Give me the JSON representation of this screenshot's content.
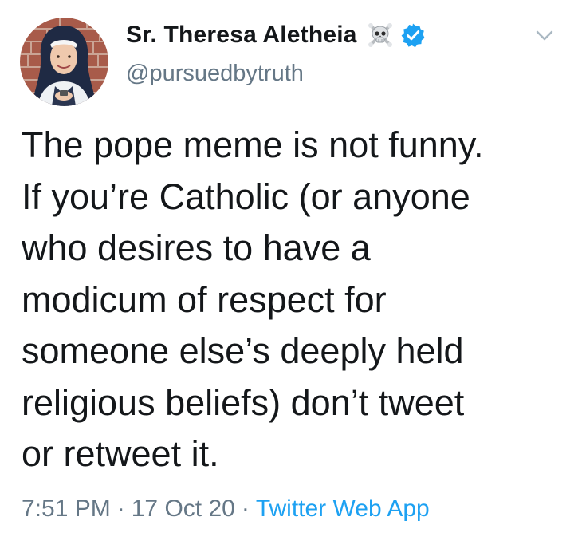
{
  "user": {
    "display_name": "Sr. Theresa Aletheia",
    "handle": "@pursuedbytruth",
    "verified": true,
    "avatar_icon": "profile-photo",
    "badge_icon": "skull-crossbones-icon"
  },
  "tweet": {
    "text": "The pope meme is not funny.\nIf you’re Catholic (or anyone\nwho desires to have a\nmodicum of respect for\nsomeone else’s deeply held\nreligious beliefs) don’t tweet\nor retweet it.",
    "time": "7:51 PM",
    "date": "17 Oct 20",
    "separator": "·",
    "source": "Twitter Web App"
  },
  "colors": {
    "text": "#14171a",
    "secondary": "#657786",
    "accent": "#1da1f2"
  }
}
